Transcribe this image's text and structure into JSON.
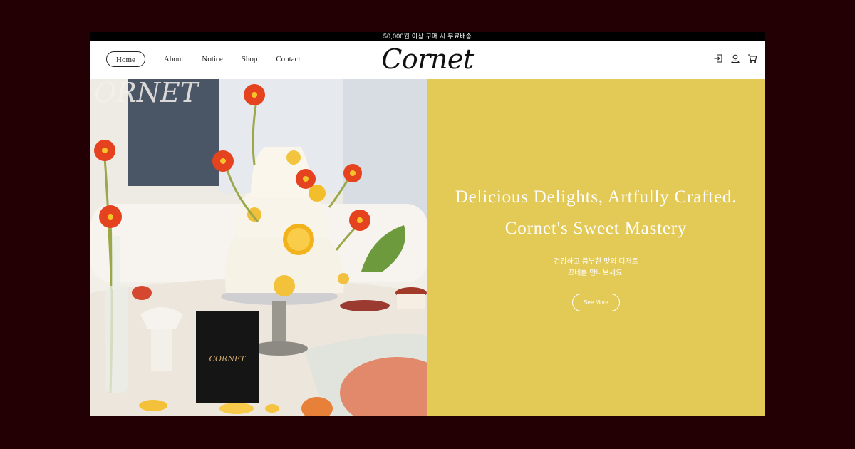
{
  "announcement": "50,000원 이상 구매 시 무료배송",
  "brand": {
    "logo_text": "Cornet"
  },
  "nav": [
    {
      "label": "Home",
      "active": true
    },
    {
      "label": "About"
    },
    {
      "label": "Notice"
    },
    {
      "label": "Shop"
    },
    {
      "label": "Contact"
    }
  ],
  "header_icons": [
    "login-icon",
    "user-icon",
    "cart-icon"
  ],
  "hero": {
    "headline_line1": "Delicious Delights, Artfully Crafted.",
    "headline_line2": "Cornet's Sweet Mastery",
    "sub_line1": "건강하고 풍부한 맛의 디저트",
    "sub_line2": "꼬네를 만나보세요.",
    "cta_label": "See More",
    "image_sign_text": "ORNET",
    "box_text": "CORNET"
  },
  "colors": {
    "page_background": "#230003",
    "panel_yellow": "#e3c955",
    "announcement_bar": "#000000",
    "text_dark": "#111111"
  }
}
